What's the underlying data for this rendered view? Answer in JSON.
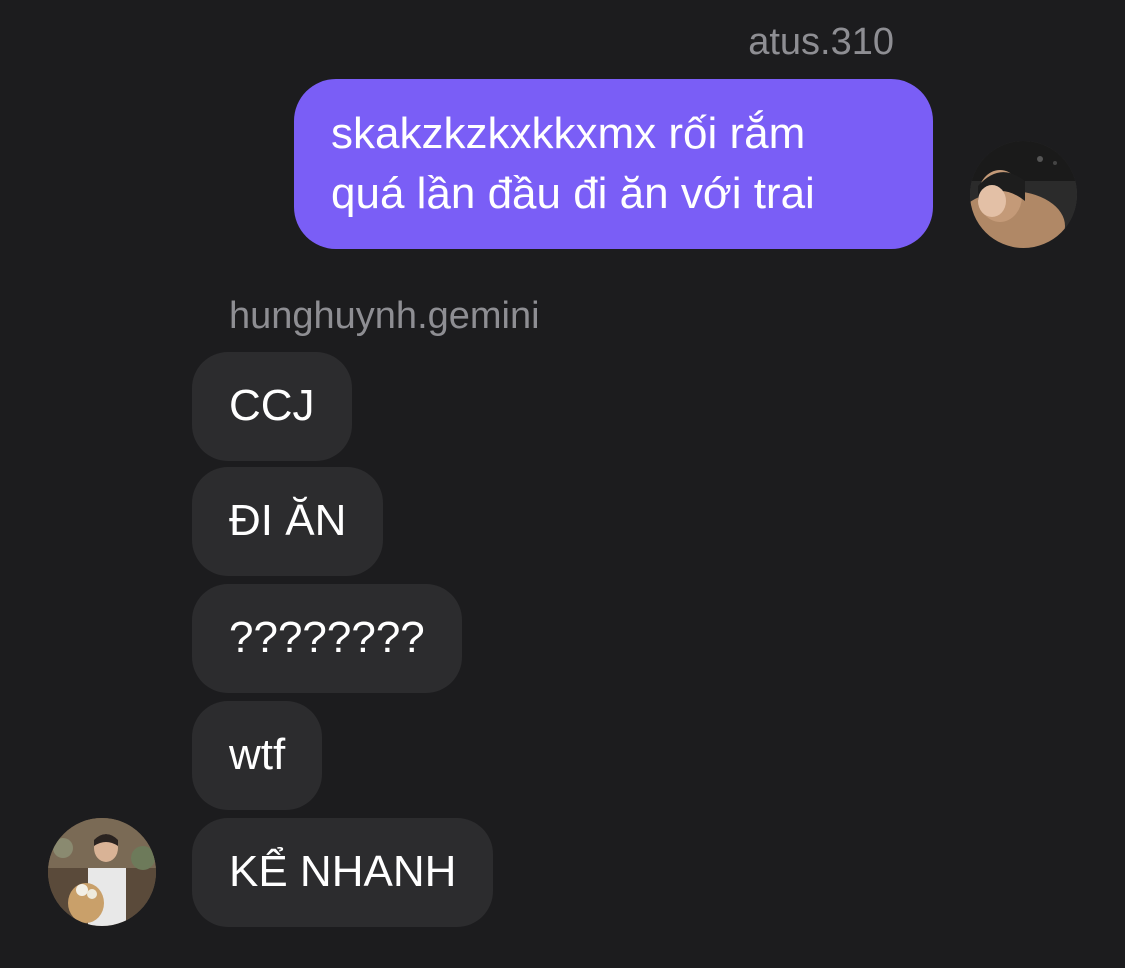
{
  "thread": {
    "sent": {
      "sender": "atus.310",
      "lines": [
        "skakzkzkxkkxmx rối rắm",
        "quá lần đầu đi ăn với trai"
      ]
    },
    "received": {
      "sender": "hunghuynh.gemini",
      "messages": [
        "CCJ",
        "ĐI ĂN",
        "????????",
        "wtf",
        "KỂ NHANH"
      ]
    }
  },
  "colors": {
    "background": "#1c1c1e",
    "outgoing_bubble": "#7a5ef6",
    "incoming_bubble": "#2c2c2e",
    "sender_name": "#8e8e93"
  }
}
